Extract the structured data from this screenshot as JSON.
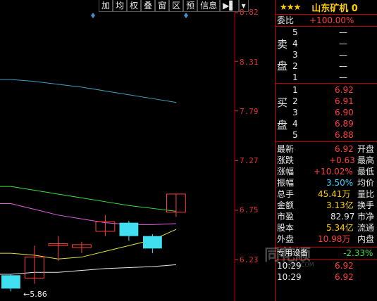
{
  "toolbar": {
    "buttons": [
      "加",
      "均",
      "权",
      "叠",
      "窗",
      "区",
      "预",
      "信息"
    ],
    "play_label": "▶▌",
    "dropdown_label": "▾"
  },
  "price_axis": {
    "labels": [
      "8.82",
      "8.31",
      "7.79",
      "7.27",
      "6.75",
      "6.23"
    ]
  },
  "low_marker": "←5.86",
  "colors": {
    "background": "#000000",
    "up": "#ff4040",
    "down": "#40e0f0",
    "divider": "#c00000",
    "accent": "#ffd000"
  },
  "stock": {
    "stars": "★★★",
    "name": "山东矿机 0"
  },
  "order_book": {
    "weibi_label": "委比",
    "weibi_value": "+100.00%",
    "sell_label_1": "卖",
    "sell_label_2": "盘",
    "buy_label_1": "买",
    "buy_label_2": "盘",
    "sell": [
      {
        "level": "5",
        "price": "—",
        "vol": "—"
      },
      {
        "level": "4",
        "price": "—",
        "vol": "—"
      },
      {
        "level": "3",
        "price": "—",
        "vol": "—"
      },
      {
        "level": "2",
        "price": "—",
        "vol": "—"
      },
      {
        "level": "1",
        "price": "—",
        "vol": "—"
      }
    ],
    "buy": [
      {
        "level": "1",
        "price": "6.92"
      },
      {
        "level": "2",
        "price": "6.91"
      },
      {
        "level": "3",
        "price": "6.90"
      },
      {
        "level": "4",
        "price": "6.89"
      },
      {
        "level": "5",
        "price": "6.88"
      }
    ]
  },
  "quote": {
    "latest_label": "最新",
    "latest": "6.92",
    "open_label": "开盘",
    "change_label": "涨跌",
    "change": "+0.63",
    "high_label": "最高",
    "pct_label": "涨幅",
    "pct": "+10.02%",
    "low_label": "最低",
    "amp_label": "振幅",
    "amp": "3.50%",
    "avg_label": "均价",
    "volume_label": "总手",
    "volume": "45.41万",
    "ratio_label": "量比",
    "amount_label": "金额",
    "amount": "3.13亿",
    "turnover_label": "换手",
    "pe_label": "市盈",
    "pe": "82.97",
    "pb_label": "市净",
    "equity_label": "股本",
    "equity": "5.34亿",
    "float_label": "流通",
    "outer_label": "外盘",
    "outer": "10.98万",
    "inner_label": "内盘"
  },
  "sector": {
    "name": "专用设备",
    "change": "-2.33%"
  },
  "ticks": [
    {
      "time": "10:29",
      "price": "6.92"
    },
    {
      "time": "10:29",
      "price": "6.92"
    }
  ],
  "watermark": "同花顺",
  "watermark_url": "10JQKA.COM",
  "chart_data": {
    "type": "candlestick",
    "y_axis_ticks": [
      8.82,
      8.31,
      7.79,
      7.27,
      6.75,
      6.23
    ],
    "ylim": [
      5.8,
      8.82
    ],
    "low_marker": 5.86,
    "candles": [
      {
        "o": 6.07,
        "c": 5.93,
        "h": 6.08,
        "l": 5.9
      },
      {
        "o": 6.04,
        "c": 6.26,
        "h": 6.38,
        "l": 5.98
      },
      {
        "o": 6.38,
        "c": 6.4,
        "h": 6.48,
        "l": 6.22
      },
      {
        "o": 6.36,
        "c": 6.39,
        "h": 6.42,
        "l": 6.3
      },
      {
        "o": 6.53,
        "c": 6.63,
        "h": 6.7,
        "l": 6.48
      },
      {
        "o": 6.62,
        "c": 6.48,
        "h": 6.64,
        "l": 6.43
      },
      {
        "o": 6.48,
        "c": 6.35,
        "h": 6.5,
        "l": 6.3
      },
      {
        "o": 6.73,
        "c": 6.92,
        "h": 6.92,
        "l": 6.68
      }
    ],
    "ma_lines": [
      {
        "name": "MA-cyan",
        "color": "#40a0c0",
        "values": [
          8.12,
          8.1,
          8.07,
          8.04,
          8.0,
          7.96,
          7.92,
          7.88
        ]
      },
      {
        "name": "MA-green",
        "color": "#40e040",
        "values": [
          7.0,
          6.96,
          6.92,
          6.88,
          6.84,
          6.8,
          6.77,
          6.74
        ]
      },
      {
        "name": "MA-magenta",
        "color": "#e060e0",
        "values": [
          6.82,
          6.76,
          6.7,
          6.66,
          6.62,
          6.6,
          6.6,
          6.61
        ]
      },
      {
        "name": "MA-yellow",
        "color": "#e0e040",
        "values": [
          6.3,
          6.28,
          6.24,
          6.26,
          6.32,
          6.38,
          6.44,
          6.55
        ]
      },
      {
        "name": "MA-white",
        "color": "#e8e8e8",
        "values": [
          6.08,
          6.1,
          6.1,
          6.12,
          6.14,
          6.15,
          6.16,
          6.18
        ]
      }
    ]
  }
}
